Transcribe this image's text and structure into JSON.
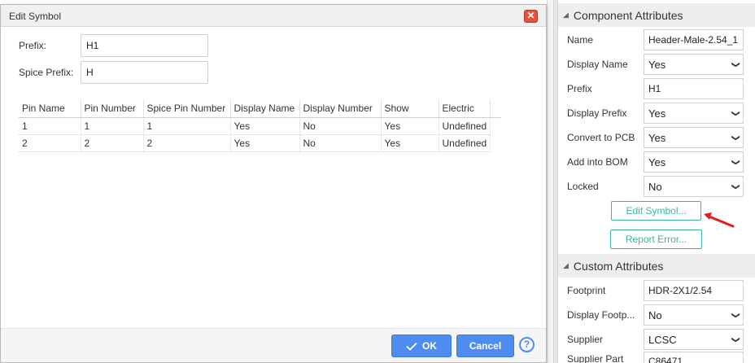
{
  "dialog": {
    "title": "Edit Symbol",
    "close_glyph": "✕",
    "fields": {
      "prefix": {
        "label": "Prefix:",
        "value": "H1"
      },
      "spice_prefix": {
        "label": "Spice Prefix:",
        "value": "H"
      }
    },
    "table": {
      "columns": [
        "Pin Name",
        "Pin Number",
        "Spice Pin Number",
        "Display Name",
        "Display Number",
        "Show",
        "Electric"
      ],
      "rows": [
        [
          "1",
          "1",
          "1",
          "Yes",
          "No",
          "Yes",
          "Undefined"
        ],
        [
          "2",
          "2",
          "2",
          "Yes",
          "No",
          "Yes",
          "Undefined"
        ]
      ]
    },
    "footer": {
      "ok_label": "OK",
      "ok_icon": "check-icon",
      "cancel_label": "Cancel",
      "help_glyph": "?"
    }
  },
  "panel": {
    "component_attributes": {
      "title": "Component Attributes",
      "name": {
        "label": "Name",
        "value": "Header-Male-2.54_1"
      },
      "display_name": {
        "label": "Display Name",
        "value": "Yes"
      },
      "prefix": {
        "label": "Prefix",
        "value": "H1"
      },
      "display_prefix": {
        "label": "Display Prefix",
        "value": "Yes"
      },
      "convert_to_pcb": {
        "label": "Convert to PCB",
        "value": "Yes"
      },
      "add_into_bom": {
        "label": "Add into BOM",
        "value": "Yes"
      },
      "locked": {
        "label": "Locked",
        "value": "No"
      },
      "edit_symbol_label": "Edit Symbol...",
      "report_error_label": "Report Error..."
    },
    "custom_attributes": {
      "title": "Custom Attributes",
      "footprint": {
        "label": "Footprint",
        "value": "HDR-2X1/2.54"
      },
      "display_footprint": {
        "label": "Display Footp...",
        "value": "No"
      },
      "supplier": {
        "label": "Supplier",
        "value": "LCSC"
      },
      "supplier_part": {
        "label": "Supplier Part",
        "value": "C86471"
      }
    }
  },
  "colors": {
    "primary": "#4e8cf0",
    "accent_green": "#3cb39a",
    "close_red": "#e0533e",
    "annotation_arrow": "#e02020"
  }
}
